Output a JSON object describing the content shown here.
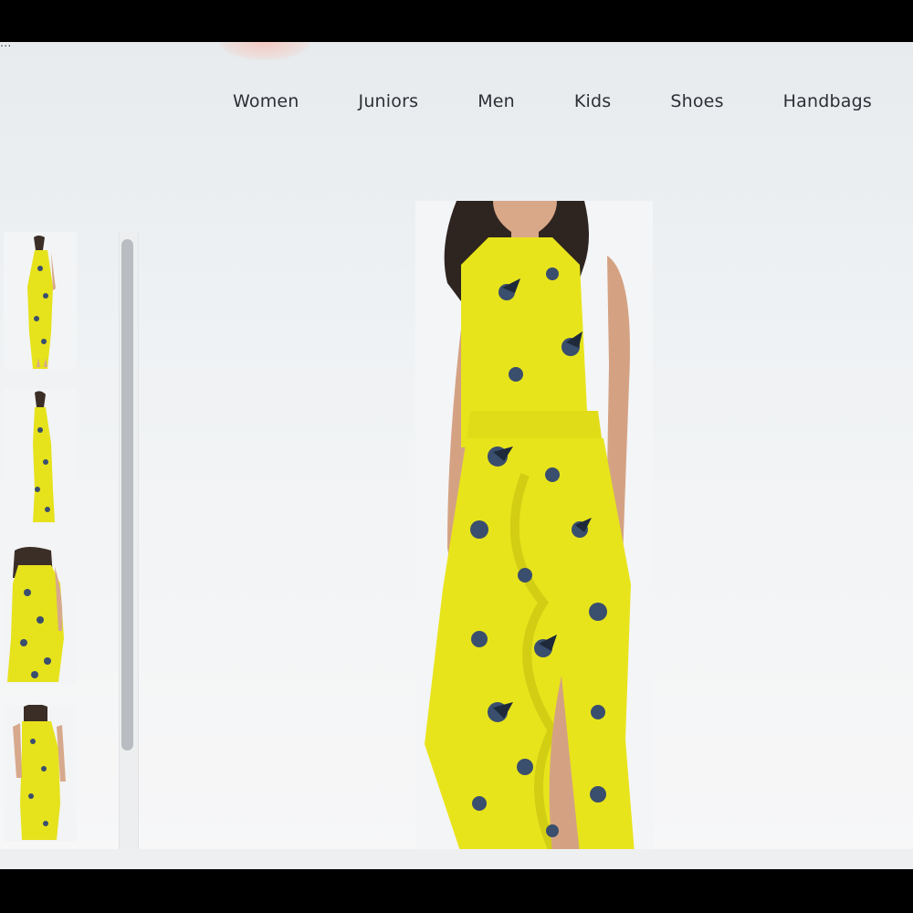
{
  "header": {
    "cropped_text": "..."
  },
  "nav": {
    "items": [
      {
        "label": "Women"
      },
      {
        "label": "Juniors"
      },
      {
        "label": "Men"
      },
      {
        "label": "Kids"
      },
      {
        "label": "Shoes"
      },
      {
        "label": "Handbags"
      }
    ]
  },
  "product": {
    "dress_color": "#e8e41c",
    "print_color": "#3a4e6e",
    "thumbnails_count_visible": 4,
    "selected_thumbnail": 1
  },
  "icons": {
    "thumbnail-1": "dress-front-full-icon",
    "thumbnail-2": "dress-side-icon",
    "thumbnail-3": "dress-detail-icon",
    "thumbnail-4": "dress-back-icon"
  }
}
